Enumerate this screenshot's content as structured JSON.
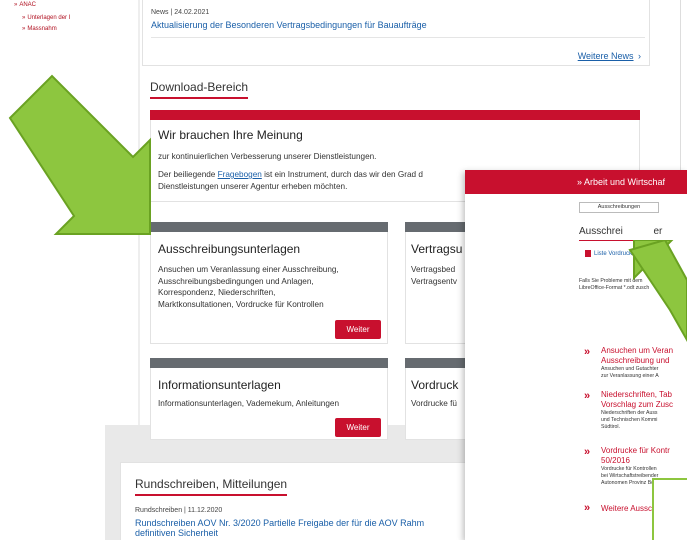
{
  "sidebar": {
    "items": [
      {
        "label": "ANAC",
        "prefix": "»"
      },
      {
        "label": "Unterlagen der I",
        "prefix": "»"
      },
      {
        "label": "Massnahm",
        "prefix": "»"
      }
    ]
  },
  "news": {
    "date": "News | 24.02.2021",
    "headline": "Aktualisierung der Besonderen Vertragsbedingungen für Bauaufträge",
    "more": "Weitere News",
    "more_arrow": "›"
  },
  "download": {
    "section_title": "Download-Bereich",
    "feedback": {
      "title": "Wir brauchen Ihre Meinung",
      "line1": "zur kontinuierlichen Verbesserung unserer Dienstleistungen.",
      "line2_pre": "Der beiliegende ",
      "line2_link": "Fragebogen",
      "line2_post": " ist ein Instrument, durch das wir den Grad d",
      "line3": "Dienstleistungen unserer Agentur erheben möchten."
    },
    "cards": [
      {
        "title": "Ausschreibungsunterlagen",
        "lines": [
          "Ansuchen um Veranlassung einer Ausschreibung,",
          "Ausschreibungsbedingungen und Anlagen,",
          "Korrespondenz, Niederschriften,",
          "Marktkonsultationen, Vordrucke für Kontrollen"
        ],
        "button": "Weiter"
      },
      {
        "title": "Vertragsu",
        "lines": [
          "Vertragsbed",
          "Vertragsentv"
        ]
      },
      {
        "title": "Informationsunterlagen",
        "lines": [
          "Informationsunterlagen, Vademekum, Anleitungen"
        ],
        "button": "Weiter"
      },
      {
        "title": "Vordruck",
        "lines": [
          "Vordrucke fü"
        ]
      }
    ]
  },
  "circulars": {
    "section_title": "Rundschreiben, Mitteilungen",
    "date": "Rundschreiben | 11.12.2020",
    "headline1": "Rundschreiben AOV Nr. 3/2020 Partielle Freigabe der für die AOV Rahm",
    "headline2": "definitiven Sicherheit"
  },
  "overlay": {
    "header": "» Arbeit und Wirtschaf",
    "tab": "Ausschreibungen",
    "title_a": "Ausschrei",
    "title_b": "er",
    "pdf_link": "Liste Vordruck",
    "note1": "Falls Sie Probleme mit dem",
    "note2": "LibreOffice-Format *.odt zusch",
    "items": [
      {
        "title": [
          "Ansuchen um Veran",
          "Ausschreibung und"
        ],
        "sub": [
          "Ansuchen und Gutachter",
          "zur Veranlassung einer A"
        ]
      },
      {
        "title": [
          "Niederschriften, Tab",
          "Vorschlag zum Zusc"
        ],
        "sub": [
          "Niederschriften der Auss",
          "und Technischen Kommi",
          "Südtirol."
        ]
      },
      {
        "title": [
          "Vordrucke für Kontr",
          "50/2016"
        ],
        "sub": [
          "Vordrucke für Kontrollen",
          "bei Wirtschaftstreibender",
          "Autonomen Provinz Boze"
        ]
      },
      {
        "title": [
          "Weitere Aussc"
        ],
        "sub": []
      }
    ]
  },
  "colors": {
    "accent": "#c8102e",
    "arrow": "#8dc63f",
    "link": "#1a5fa8",
    "bar": "#666b70"
  }
}
